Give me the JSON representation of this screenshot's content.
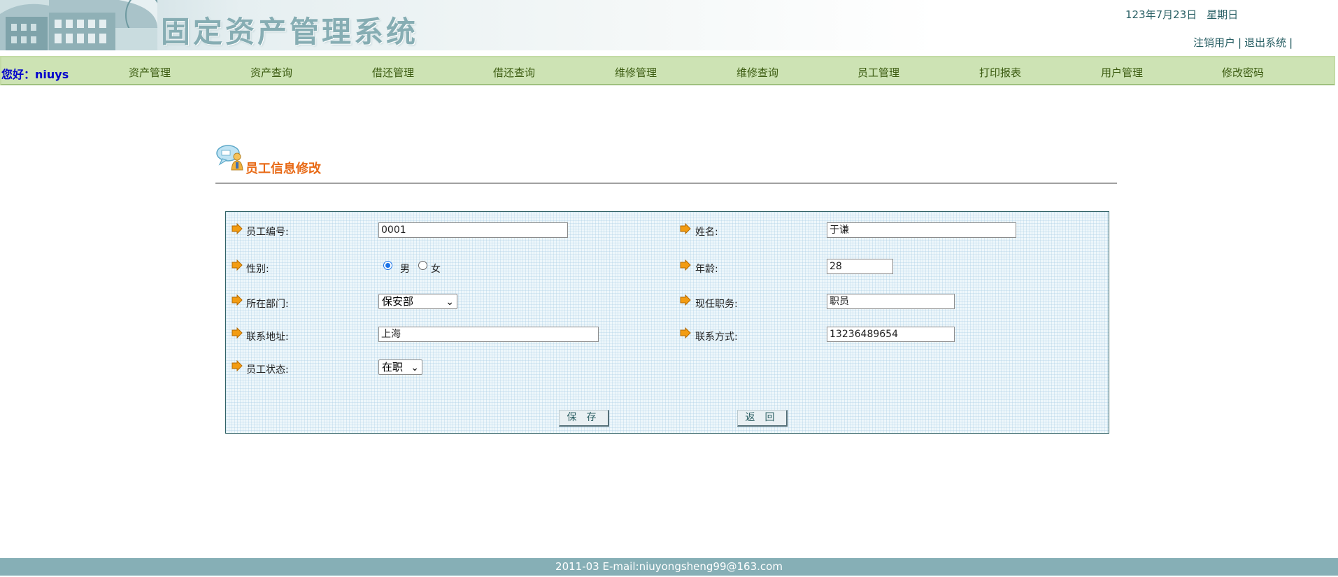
{
  "header": {
    "title": "固定资产管理系统",
    "date": "123年7月23日",
    "weekday": "星期日",
    "links": {
      "logout_user": "注销用户",
      "exit_system": "退出系统",
      "separator": "|"
    }
  },
  "nav": {
    "greeting": "您好：niuys",
    "items": [
      "资产管理",
      "资产查询",
      "借还管理",
      "借还查询",
      "维修管理",
      "维修查询",
      "员工管理",
      "打印报表",
      "用户管理",
      "修改密码"
    ]
  },
  "page": {
    "heading": "员工信息修改"
  },
  "form": {
    "employee_id": {
      "label": "员工编号:",
      "value": "0001"
    },
    "name": {
      "label": "姓名:",
      "value": "于谦"
    },
    "gender": {
      "label": "性别:",
      "options": [
        "男",
        "女"
      ],
      "selected": "男"
    },
    "age": {
      "label": "年龄:",
      "value": "28"
    },
    "department": {
      "label": "所在部门:",
      "selected": "保安部"
    },
    "position": {
      "label": "现任职务:",
      "value": "职员"
    },
    "address": {
      "label": "联系地址:",
      "value": "上海"
    },
    "contact": {
      "label": "联系方式:",
      "value": "13236489654"
    },
    "status": {
      "label": "员工状态:",
      "selected": "在职"
    },
    "save_label": "保存",
    "back_label": "返回"
  },
  "footer": {
    "text": "2011-03 E-mail:niuyongsheng99@163.com"
  },
  "colors": {
    "accent": "#e86a16",
    "nav_bg": "#cde3b4",
    "footer_bg": "#86afb6",
    "header_text": "#86adb3"
  }
}
